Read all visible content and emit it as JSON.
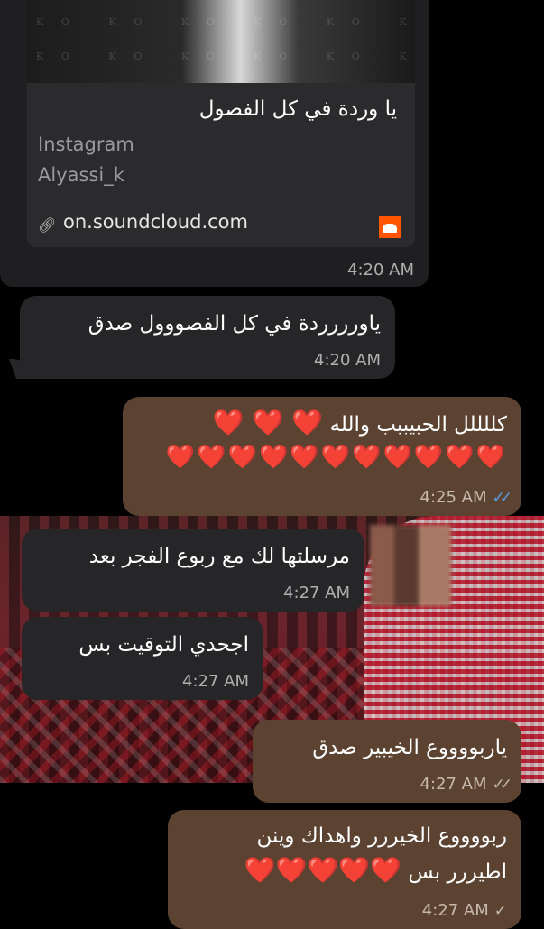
{
  "link_preview": {
    "title": "يا وردة في كل الفصول",
    "site": "Instagram",
    "author": "Alyassi_k",
    "url": "on.soundcloud.com",
    "watermark": "KO",
    "time": "4:20 AM",
    "icon": "soundcloud-icon"
  },
  "messages": [
    {
      "text": "ياورررردة في كل الفصووول صدق",
      "time": "4:20 AM",
      "direction": "incoming"
    },
    {
      "text": "كللللل الحبيببب والله",
      "hearts_line1": "❤️ ❤️ ❤️",
      "hearts_line2": "❤️❤️❤️❤️❤️❤️❤️❤️❤️❤️❤️",
      "time": "4:25 AM",
      "direction": "outgoing",
      "status": "read"
    },
    {
      "text": "مرسلتها لك مع ربوع الفجر بعد",
      "time": "4:27 AM",
      "direction": "incoming"
    },
    {
      "text": "اجحدي التوقيت بس",
      "time": "4:27 AM",
      "direction": "incoming"
    },
    {
      "text": "ياربووووع الخيبير صدق",
      "time": "4:27 AM",
      "direction": "outgoing",
      "status": "delivered"
    },
    {
      "text_line1": "ربووووع الخيررر واهداك وينن",
      "text_line2": "اطيررر بس",
      "hearts": "❤️❤️❤️❤️❤️",
      "time": "4:27 AM",
      "direction": "outgoing",
      "status": "sent"
    }
  ],
  "colors": {
    "incoming_bubble": "#262628",
    "outgoing_bubble": "#5b4231",
    "read_ticks": "#5aa0e6"
  }
}
